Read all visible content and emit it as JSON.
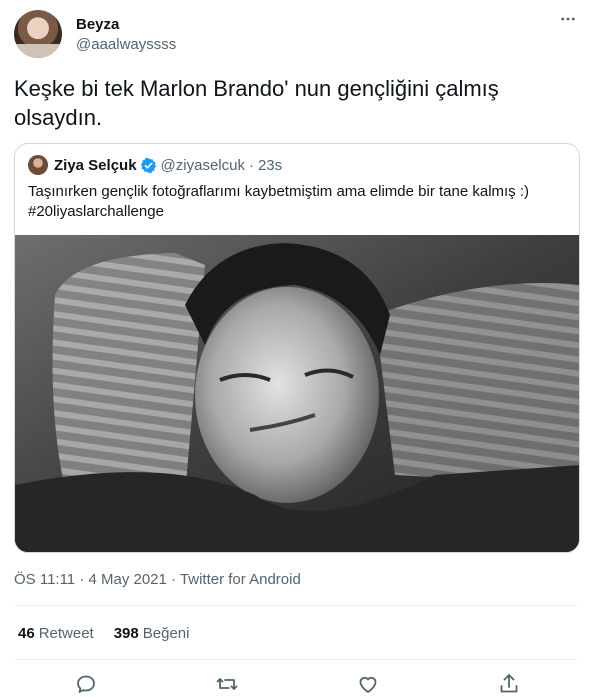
{
  "author": {
    "name": "Beyza",
    "handle": "@aaalwayssss"
  },
  "tweet": {
    "text": "Keşke bi tek Marlon Brando' nun gençliğini çalmış olsaydın."
  },
  "quoted_tweet": {
    "name": "Ziya Selçuk",
    "handle": "@ziyaselcuk",
    "separator": "·",
    "time": "23s",
    "text_line1": "Taşınırken gençlik fotoğraflarımı kaybetmiştim ama elimde bir tane kalmış :)",
    "text_line2": "#20liyaslarchallenge"
  },
  "meta": {
    "text": "ÖS 11:11 · 4 May 2021 · Twitter for Android"
  },
  "stats": {
    "retweets_count": "46",
    "retweets_label": "Retweet",
    "likes_count": "398",
    "likes_label": "Beğeni"
  },
  "icons": {
    "more": "more-icon",
    "verified": "verified-badge-icon",
    "reply": "reply-icon",
    "retweet": "retweet-icon",
    "like": "like-icon",
    "share": "share-icon"
  },
  "colors": {
    "text": "#0f1419",
    "secondary": "#536471",
    "verified": "#1d9bf0",
    "border": "#cfd9de"
  }
}
